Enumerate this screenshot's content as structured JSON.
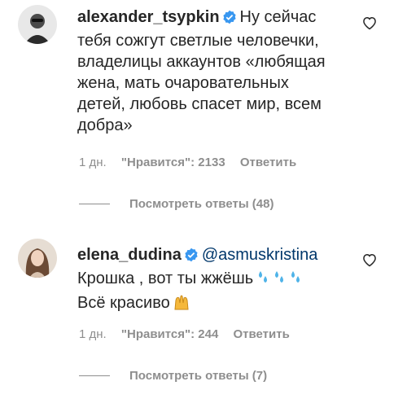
{
  "comments": [
    {
      "username": "alexander_tsypkin",
      "text_lines": [
        "Ну сейчас",
        "тебя сожгут светлые человечки,",
        "владелицы аккаунтов «любящая",
        "жена, мать очаровательных",
        "детей, любовь спасет мир, всем",
        "добра»"
      ],
      "time": "1 дн.",
      "likes": "\"Нравится\": 2133",
      "reply_label": "Ответить",
      "view_replies": "Посмотреть ответы (48)"
    },
    {
      "username": "elena_dudina",
      "mention": "@asmuskristina",
      "text_line1": "Крошка , вот ты жжёшь",
      "text_line2": "Всё красиво",
      "time": "1 дн.",
      "likes": "\"Нравится\": 244",
      "reply_label": "Ответить",
      "view_replies": "Посмотреть ответы (7)"
    }
  ],
  "icons": {
    "verified_color": "#3897f0",
    "heart": "heart-outline-icon"
  }
}
